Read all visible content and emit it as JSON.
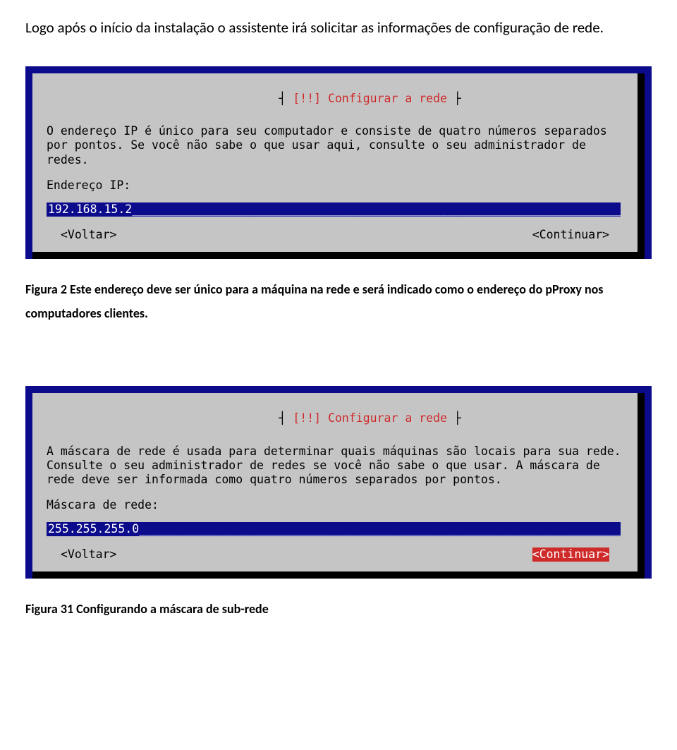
{
  "doc": {
    "intro": "Logo após o início da instalação o assistente irá solicitar as informações de configuração de rede.",
    "caption1": "Figura 2 Este endereço deve ser único para a máquina na rede e será indicado como o endereço do pProxy nos computadores clientes.",
    "caption2": "Figura 31 Configurando a máscara de sub-rede"
  },
  "term1": {
    "title_marker": "[!!]",
    "title": "Configurar a rede",
    "para": "O endereço IP é único para seu computador e consiste de quatro números separados por pontos. Se você não sabe o que usar aqui, consulte o seu administrador de redes.",
    "label": "Endereço IP:",
    "input_value": "192.168.15.2",
    "input_fill": "_________________________________________________________________________________________",
    "back": "<Voltar>",
    "continue": "<Continuar>",
    "continue_focused": false
  },
  "term2": {
    "title_marker": "[!!]",
    "title": "Configurar a rede",
    "para": "A máscara de rede é usada para determinar quais máquinas são locais para sua rede. Consulte o seu administrador de redes se você não sabe o que usar. A máscara de rede deve ser informada como quatro números separados por pontos.",
    "label": "Máscara de rede:",
    "input_value": "255.255.255.0",
    "input_fill": "________________________________________________________________________________________",
    "back": "<Voltar>",
    "continue": "<Continuar>",
    "continue_focused": true
  }
}
